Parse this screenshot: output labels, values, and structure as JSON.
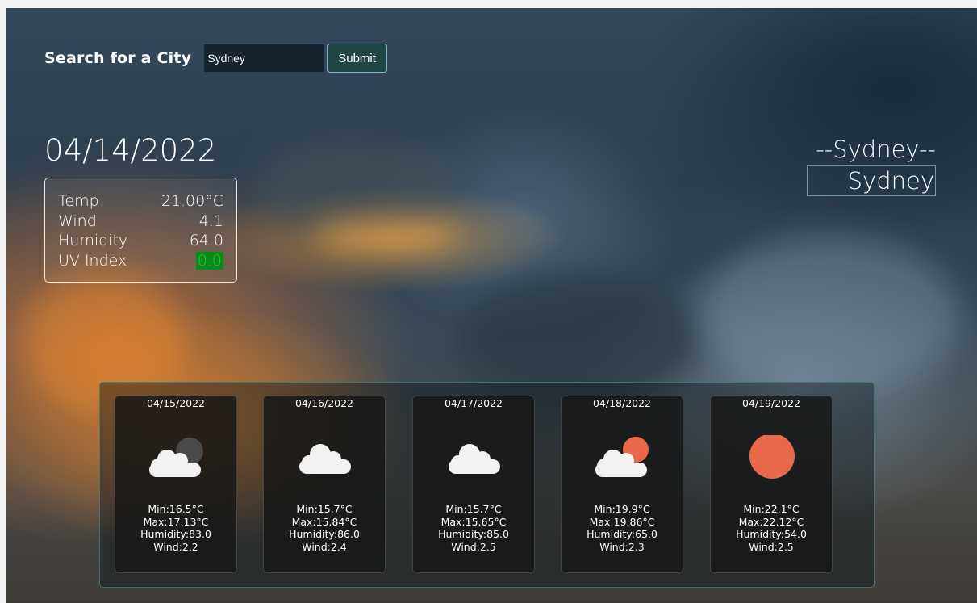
{
  "search": {
    "title": "Search for a City",
    "input_value": "Sydney",
    "submit_label": "Submit"
  },
  "current": {
    "date": "04/14/2022",
    "labels": {
      "temp": "Temp",
      "wind": "Wind",
      "humidity": "Humidity",
      "uv": "UV Index"
    },
    "values": {
      "temp": "21.00°C",
      "wind": "4.1",
      "humidity": "64.0",
      "uv": "0.0"
    },
    "uv_color": "#0a8a1a"
  },
  "city": {
    "heading": "--Sydney--",
    "name": "Sydney"
  },
  "forecast": [
    {
      "date": "04/15/2022",
      "icon": "cloudy-night-icon",
      "min": "Min:16.5°C",
      "max": "Max:17.13°C",
      "humidity": "Humidity:83.0",
      "wind": "Wind:2.2"
    },
    {
      "date": "04/16/2022",
      "icon": "cloud-icon",
      "min": "Min:15.7°C",
      "max": "Max:15.84°C",
      "humidity": "Humidity:86.0",
      "wind": "Wind:2.4"
    },
    {
      "date": "04/17/2022",
      "icon": "cloud-icon",
      "min": "Min:15.7°C",
      "max": "Max:15.65°C",
      "humidity": "Humidity:85.0",
      "wind": "Wind:2.5"
    },
    {
      "date": "04/18/2022",
      "icon": "partly-cloudy-icon",
      "min": "Min:19.9°C",
      "max": "Max:19.86°C",
      "humidity": "Humidity:65.0",
      "wind": "Wind:2.3"
    },
    {
      "date": "04/19/2022",
      "icon": "sun-icon",
      "min": "Min:22.1°C",
      "max": "Max:22.12°C",
      "humidity": "Humidity:54.0",
      "wind": "Wind:2.5"
    }
  ],
  "colors": {
    "sun": "#e8694a",
    "moon": "#4a4a4a",
    "cloud": "#f2f2f2",
    "submit_bg": "#1e4744"
  }
}
